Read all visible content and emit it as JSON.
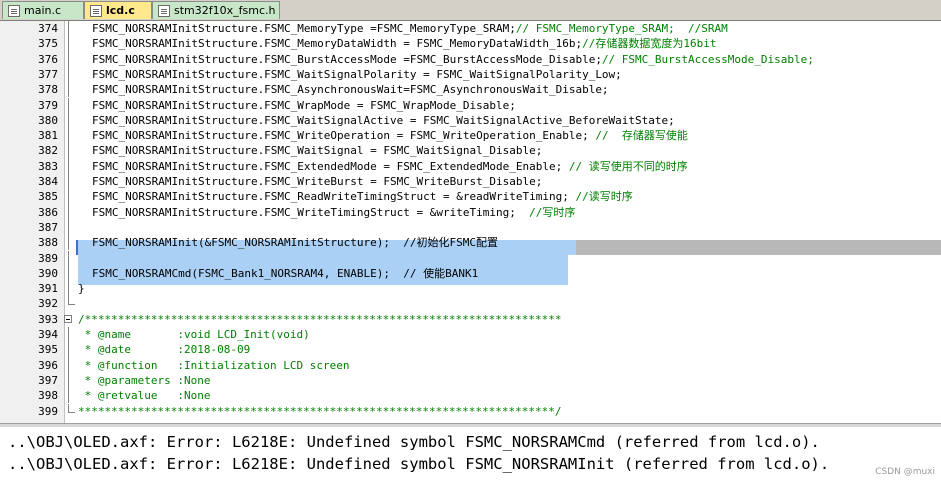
{
  "tabs": [
    {
      "label": "main.c",
      "active": false
    },
    {
      "label": "lcd.c",
      "active": true
    },
    {
      "label": "stm32f10x_fsmc.h",
      "active": false
    }
  ],
  "code_lines": [
    {
      "num": "374",
      "code": "FSMC_NORSRAMInitStructure.FSMC_MemoryType =FSMC_MemoryType_SRAM;",
      "comment": "// FSMC_MemoryType_SRAM;  //SRAM"
    },
    {
      "num": "375",
      "code": "FSMC_NORSRAMInitStructure.FSMC_MemoryDataWidth = FSMC_MemoryDataWidth_16b;",
      "comment": "//存储器数据宽度为16bit"
    },
    {
      "num": "376",
      "code": "FSMC_NORSRAMInitStructure.FSMC_BurstAccessMode =FSMC_BurstAccessMode_Disable;",
      "comment": "// FSMC_BurstAccessMode_Disable;"
    },
    {
      "num": "377",
      "code": "FSMC_NORSRAMInitStructure.FSMC_WaitSignalPolarity = FSMC_WaitSignalPolarity_Low;",
      "comment": ""
    },
    {
      "num": "378",
      "code": "FSMC_NORSRAMInitStructure.FSMC_AsynchronousWait=FSMC_AsynchronousWait_Disable;",
      "comment": ""
    },
    {
      "num": "379",
      "code": "FSMC_NORSRAMInitStructure.FSMC_WrapMode = FSMC_WrapMode_Disable;",
      "comment": ""
    },
    {
      "num": "380",
      "code": "FSMC_NORSRAMInitStructure.FSMC_WaitSignalActive = FSMC_WaitSignalActive_BeforeWaitState;",
      "comment": ""
    },
    {
      "num": "381",
      "code": "FSMC_NORSRAMInitStructure.FSMC_WriteOperation = FSMC_WriteOperation_Enable; ",
      "comment": "//  存储器写使能"
    },
    {
      "num": "382",
      "code": "FSMC_NORSRAMInitStructure.FSMC_WaitSignal = FSMC_WaitSignal_Disable;",
      "comment": ""
    },
    {
      "num": "383",
      "code": "FSMC_NORSRAMInitStructure.FSMC_ExtendedMode = FSMC_ExtendedMode_Enable; ",
      "comment": "// 读写使用不同的时序"
    },
    {
      "num": "384",
      "code": "FSMC_NORSRAMInitStructure.FSMC_WriteBurst = FSMC_WriteBurst_Disable;",
      "comment": ""
    },
    {
      "num": "385",
      "code": "FSMC_NORSRAMInitStructure.FSMC_ReadWriteTimingStruct = &readWriteTiming; ",
      "comment": "//读写时序"
    },
    {
      "num": "386",
      "code": "FSMC_NORSRAMInitStructure.FSMC_WriteTimingStruct = &writeTiming;  ",
      "comment": "//写时序"
    },
    {
      "num": "387",
      "code": "",
      "comment": ""
    },
    {
      "num": "388",
      "code": "FSMC_NORSRAMInit(&FSMC_NORSRAMInitStructure);  //初始化FSMC配置",
      "comment": ""
    },
    {
      "num": "389",
      "code": "",
      "comment": ""
    },
    {
      "num": "390",
      "code": "FSMC_NORSRAMCmd(FSMC_Bank1_NORSRAM4, ENABLE);  // 使能BANK1",
      "comment": ""
    },
    {
      "num": "391",
      "code": "}",
      "comment": ""
    },
    {
      "num": "392",
      "code": "",
      "comment": ""
    },
    {
      "num": "393",
      "code": "",
      "comment": "/************************************************************************"
    },
    {
      "num": "394",
      "code": "",
      "comment": " * @name       :void LCD_Init(void)"
    },
    {
      "num": "395",
      "code": "",
      "comment": " * @date       :2018-08-09"
    },
    {
      "num": "396",
      "code": "",
      "comment": " * @function   :Initialization LCD screen"
    },
    {
      "num": "397",
      "code": "",
      "comment": " * @parameters :None"
    },
    {
      "num": "398",
      "code": "",
      "comment": " * @retvalue   :None"
    },
    {
      "num": "399",
      "code": "",
      "comment": "************************************************************************/"
    }
  ],
  "output_lines": [
    "..\\OBJ\\OLED.axf: Error: L6218E: Undefined symbol FSMC_NORSRAMCmd (referred from lcd.o).",
    "..\\OBJ\\OLED.axf: Error: L6218E: Undefined symbol FSMC_NORSRAMInit (referred from lcd.o)."
  ],
  "watermark": "CSDN @muxi",
  "icons": {
    "file_tab": "document-icon",
    "fold_open": "fold-minus-icon"
  },
  "colors": {
    "comment": "#008000",
    "selection": "#aad0f5",
    "current_line": "#b8b8b8",
    "active_tab": "#ffe98c",
    "inactive_tab": "#c8e6c8"
  }
}
